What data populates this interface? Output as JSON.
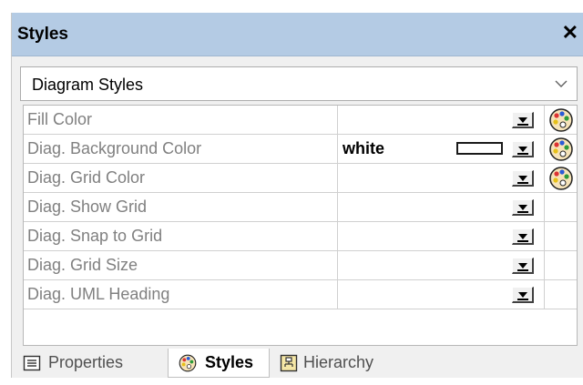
{
  "panel": {
    "title": "Styles",
    "close_glyph": "✕",
    "close_icon": "close-icon"
  },
  "selector": {
    "selected": "Diagram Styles",
    "chevron_icon": "chevron-down-icon"
  },
  "properties": [
    {
      "name": "Fill Color",
      "value": "",
      "has_swatch": false,
      "has_picker": true
    },
    {
      "name": "Diag. Background Color",
      "value": "white",
      "has_swatch": true,
      "has_picker": true
    },
    {
      "name": "Diag. Grid Color",
      "value": "",
      "has_swatch": false,
      "has_picker": true
    },
    {
      "name": "Diag. Show Grid",
      "value": "",
      "has_swatch": false,
      "has_picker": false
    },
    {
      "name": "Diag. Snap to Grid",
      "value": "",
      "has_swatch": false,
      "has_picker": false
    },
    {
      "name": "Diag. Grid Size",
      "value": "",
      "has_swatch": false,
      "has_picker": false
    },
    {
      "name": "Diag. UML Heading",
      "value": "",
      "has_swatch": false,
      "has_picker": false
    }
  ],
  "tabs": [
    {
      "label": "Properties",
      "icon": "properties-list-icon",
      "active": false
    },
    {
      "label": "Styles",
      "icon": "palette-icon",
      "active": true
    },
    {
      "label": "Hierarchy",
      "icon": "hierarchy-icon",
      "active": false
    }
  ],
  "colors": {
    "titlebar": "#b4cbe4",
    "panel_bg": "#f0f0f0",
    "property_name_text": "#808080"
  }
}
